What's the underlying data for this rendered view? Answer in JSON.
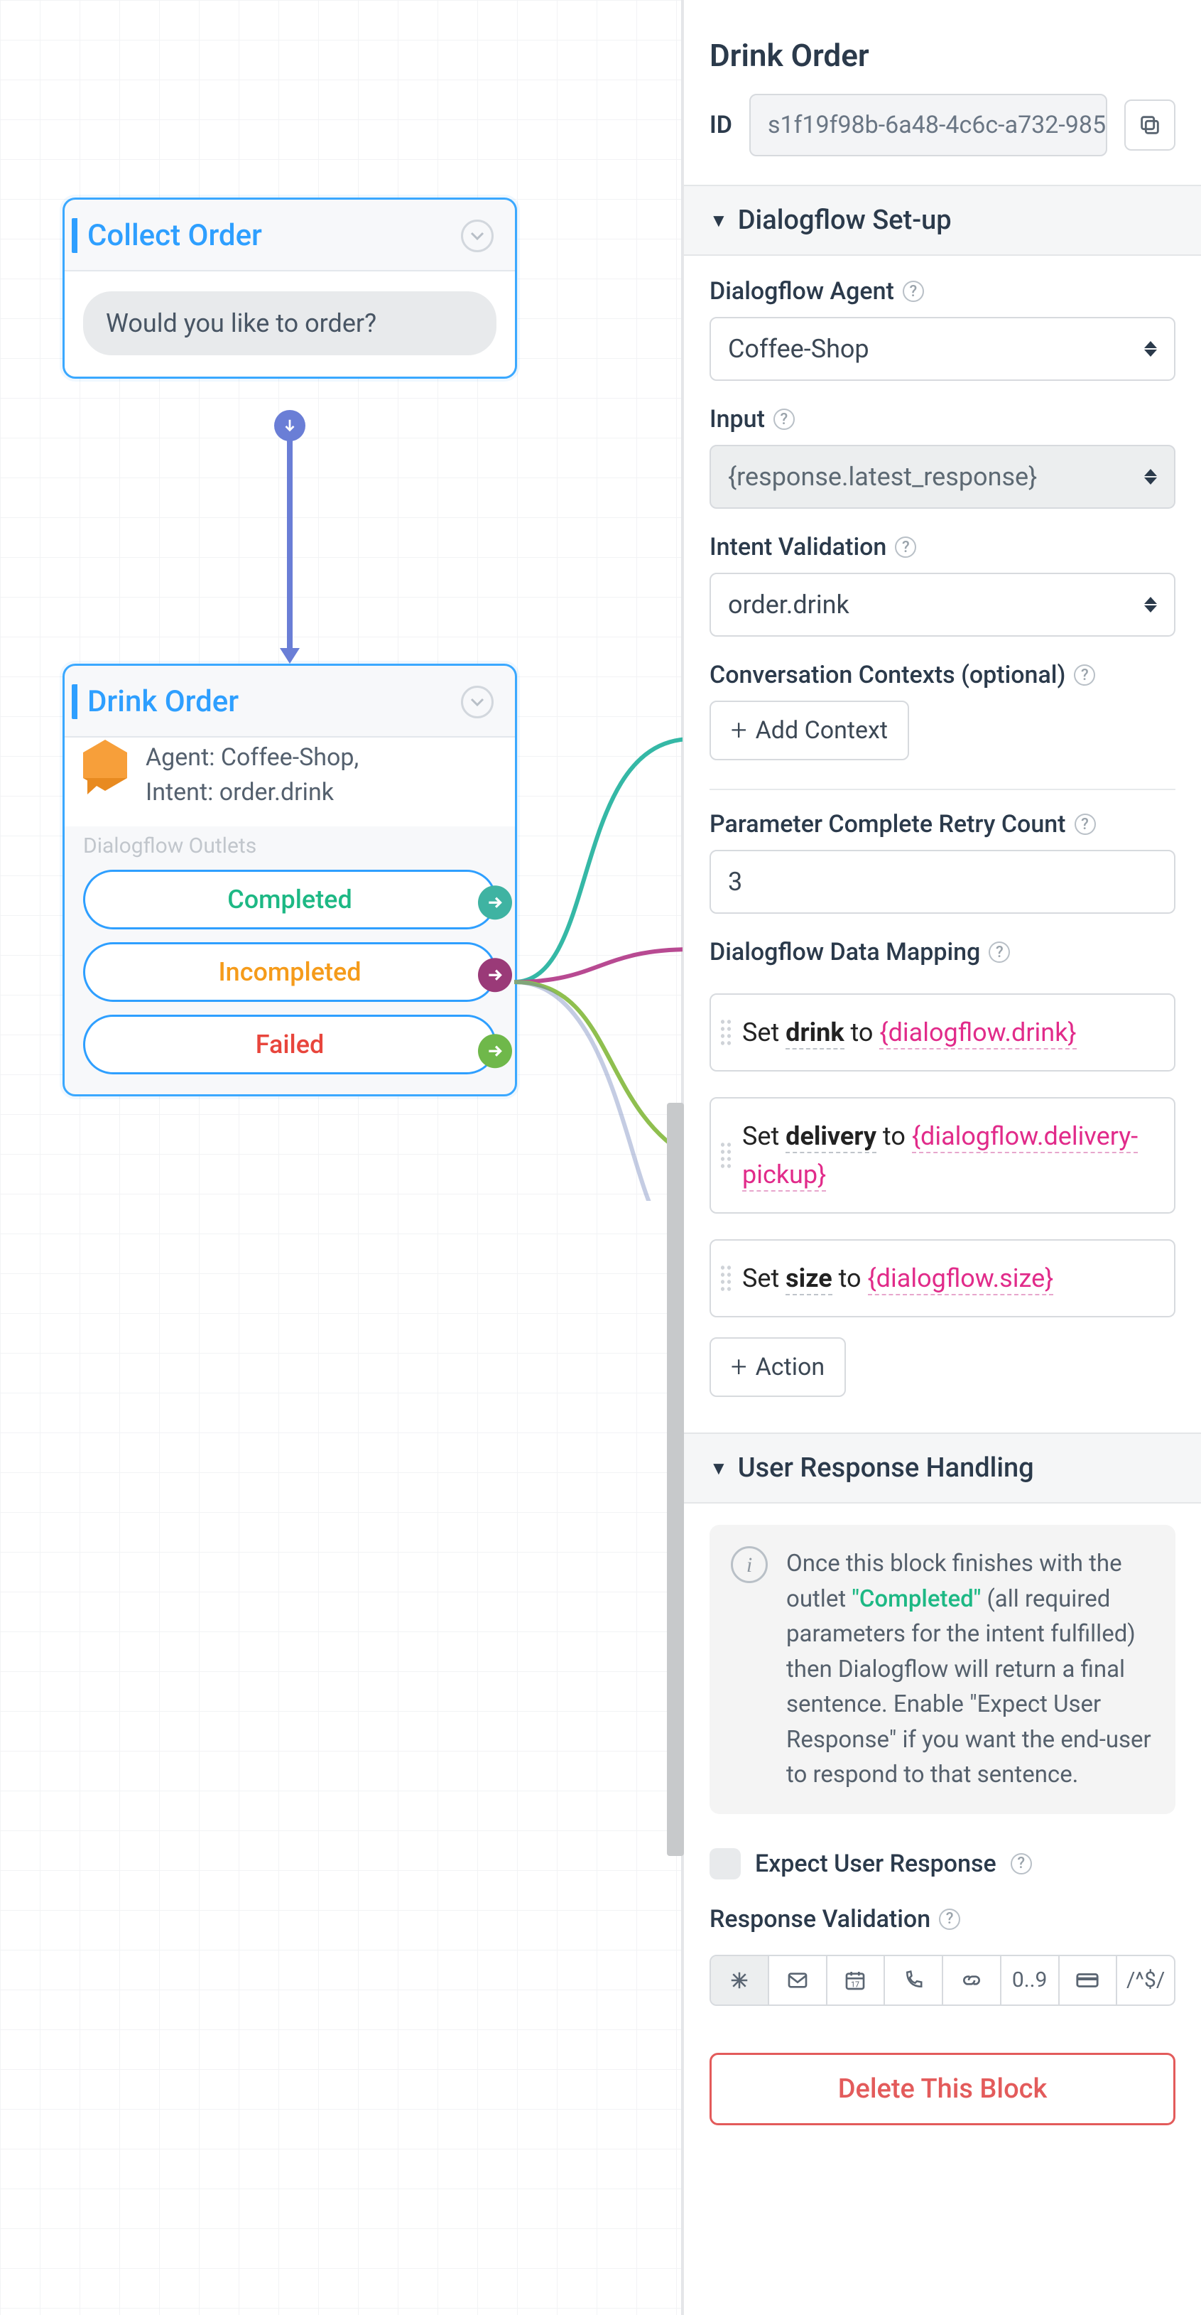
{
  "canvas": {
    "node_collect": {
      "title": "Collect Order",
      "prompt": "Would you like to order?"
    },
    "node_drink": {
      "title": "Drink Order",
      "agent_line": "Agent: Coffee-Shop,",
      "intent_line": "Intent: order.drink",
      "outlets_label": "Dialogflow Outlets",
      "outlets": [
        {
          "label": "Completed",
          "color": "#1db884",
          "dot": "#3fb3a2"
        },
        {
          "label": "Incompleted",
          "color": "#f59b1a",
          "dot": "#9a3a78"
        },
        {
          "label": "Failed",
          "color": "#e8453c",
          "dot": "#6fb84a"
        }
      ]
    }
  },
  "panel": {
    "title": "Drink Order",
    "id_label": "ID",
    "id_value": "s1f19f98b-6a48-4c6c-a732-985",
    "sections": {
      "setup_title": "Dialogflow Set-up",
      "agent_label": "Dialogflow Agent",
      "agent_value": "Coffee-Shop",
      "input_label": "Input",
      "input_value": "{response.latest_response}",
      "intent_label": "Intent Validation",
      "intent_value": "order.drink",
      "contexts_label": "Conversation Contexts (optional)",
      "add_context": "Add Context",
      "retry_label": "Parameter Complete Retry Count",
      "retry_value": "3",
      "mapping_label": "Dialogflow Data Mapping",
      "mappings": [
        {
          "set": "Set ",
          "var": "drink",
          "to": " to  ",
          "val": "{dialogflow.drink}"
        },
        {
          "set": "Set ",
          "var": "delivery",
          "to": " to  ",
          "val": "{dialogflow.delivery-pickup}"
        },
        {
          "set": "Set ",
          "var": "size",
          "to": " to  ",
          "val": "{dialogflow.size}"
        }
      ],
      "add_action": "Action",
      "user_resp_title": "User Response Handling",
      "info_pre": "Once this block finishes with the outlet ",
      "info_completed": "\"Completed\"",
      "info_post": " (all required parameters for the intent fulfilled) then Dialogflow will return a final sentence. Enable \"Expect User Response\" if you want the end-user to respond to that sentence.",
      "expect_label": "Expect User Response",
      "validation_label": "Response Validation",
      "validation_tabs": [
        "*",
        "mail",
        "cal",
        "phone",
        "link",
        "0..9",
        "card",
        "/^$/"
      ],
      "delete": "Delete This Block"
    }
  }
}
